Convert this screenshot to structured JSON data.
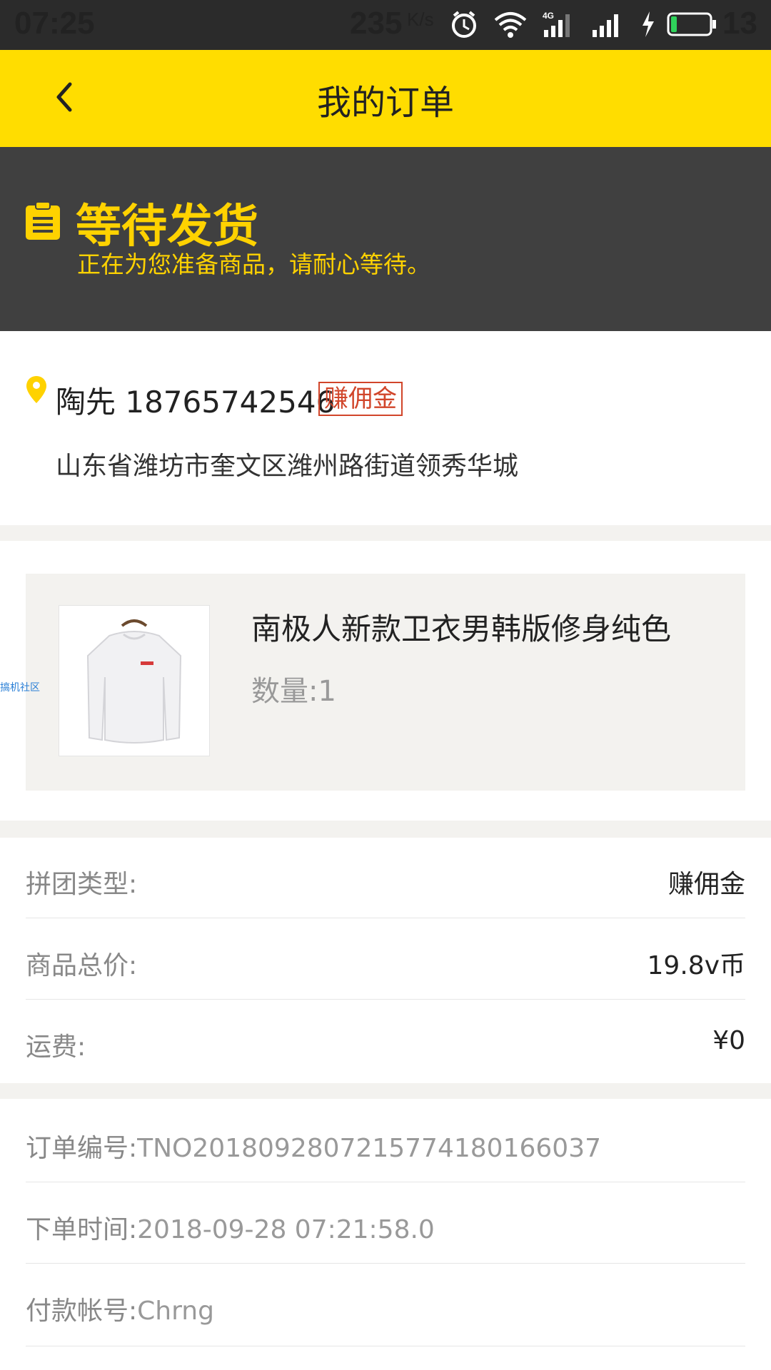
{
  "status_bar": {
    "time": "07:25",
    "speed": "235",
    "speed_unit": "K/s",
    "battery": "13",
    "icons": [
      "alarm-icon",
      "wifi-icon",
      "4g-signal-icon",
      "signal-icon",
      "charging-icon",
      "battery-icon"
    ]
  },
  "nav": {
    "title": "我的订单",
    "back_icon": "chevron-left-icon"
  },
  "banner": {
    "title": "等待发货",
    "subtitle": "正在为您准备商品，请耐心等待。",
    "icon": "clipboard-icon"
  },
  "address": {
    "name_phone": "陶先 18765742546",
    "badge": "赚佣金",
    "address": "山东省潍坊市奎文区潍州路街道领秀华城",
    "icon": "location-pin-icon"
  },
  "product": {
    "title": "南极人新款卫衣男韩版修身纯色",
    "quantity": "数量:1",
    "watermark": "搞机社区"
  },
  "summary": [
    {
      "label": "拼团类型:",
      "value": "赚佣金"
    },
    {
      "label": "商品总价:",
      "value": "19.8v币"
    },
    {
      "label": "运费:",
      "value": "¥0"
    }
  ],
  "order_info": [
    {
      "label": "订单编号:",
      "value": "TNO2018092807215774180166037"
    },
    {
      "label": "下单时间:",
      "value": "2018-09-28 07:21:58.0"
    },
    {
      "label": "付款帐号:",
      "value": "Chrng"
    }
  ],
  "colors": {
    "nav_yellow": "#ffdd00",
    "banner_dark": "#404040",
    "banner_text": "#ffd200",
    "badge_red": "#d1452a"
  }
}
